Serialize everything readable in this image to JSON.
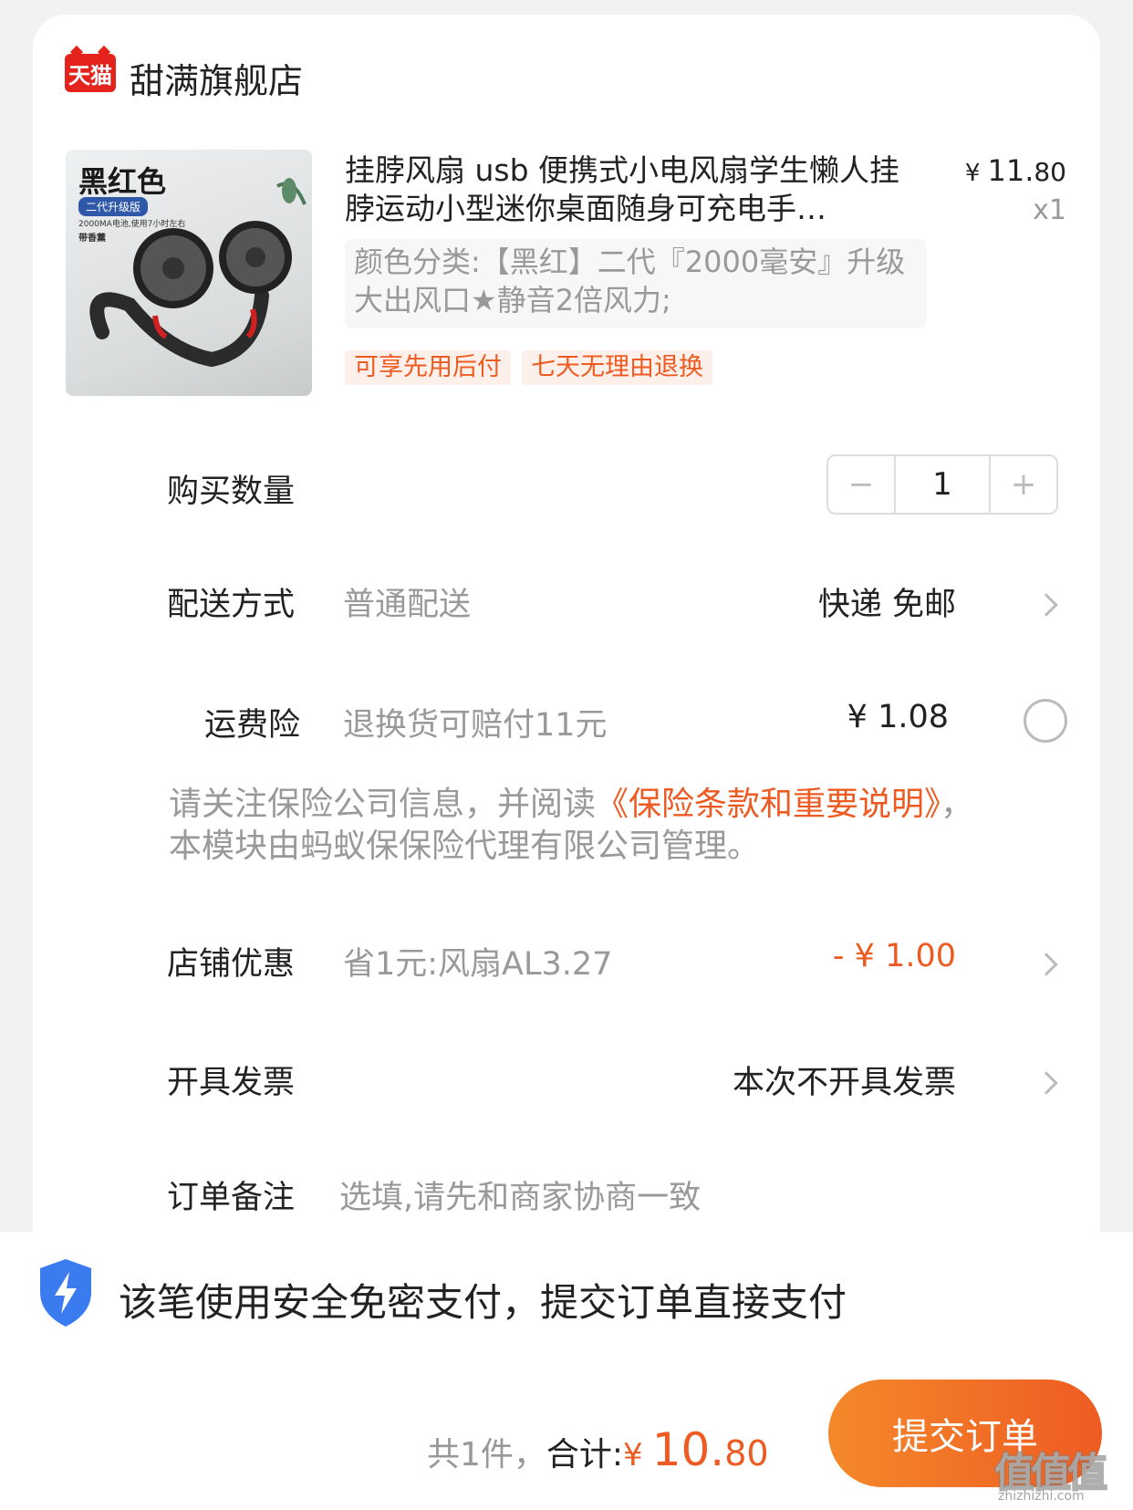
{
  "shop": {
    "logo_text": "天猫",
    "name": "甜满旗舰店"
  },
  "product": {
    "thumb_title": "黑红色",
    "thumb_badge": "二代升级版",
    "thumb_spec": "2000MA电池,使用7小时左右",
    "thumb_scent": "带香薰",
    "title": "挂脖风扇 usb 便携式小电风扇学生懒人挂脖运动小型迷你桌面随身可充电手…",
    "price_currency": "¥",
    "price_int": "11.",
    "price_dec": "80",
    "quantity_label": "x1",
    "sku": "颜色分类:【黑红】二代『2000毫安』升级大出风口★静音2倍风力;",
    "tags": [
      "可享先用后付",
      "七天无理由退换"
    ]
  },
  "quantity": {
    "label": "购买数量",
    "value": "1",
    "minus": "−",
    "plus": "+"
  },
  "delivery": {
    "label": "配送方式",
    "sub": "普通配送",
    "value": "快递 免邮"
  },
  "insurance": {
    "label": "运费险",
    "sub": "退换货可赔付11元",
    "price": "¥ 1.08",
    "notice_pre": "请关注保险公司信息，并阅读",
    "notice_link": "《保险条款和重要说明》",
    "notice_post": "，本模块由蚂蚁保保险代理有限公司管理。"
  },
  "discount": {
    "label": "店铺优惠",
    "sub": "省1元:风扇AL3.27",
    "value": "- ¥ 1.00"
  },
  "invoice": {
    "label": "开具发票",
    "value": "本次不开具发票"
  },
  "remark": {
    "label": "订单备注",
    "placeholder": "选填,请先和商家协商一致"
  },
  "secure": {
    "text": "该笔使用安全免密支付，提交订单直接支付"
  },
  "footer": {
    "count_text": "共1件，",
    "total_label": "合计:",
    "currency": "¥",
    "total_int": "10.",
    "total_dec": "80",
    "submit": "提交订单"
  },
  "watermark": {
    "main": "值值值",
    "sub": "zhizhizhi.com"
  },
  "colors": {
    "accent": "#ee5b22",
    "tmall_red": "#e4231c",
    "shield_blue": "#3a7bf0"
  }
}
